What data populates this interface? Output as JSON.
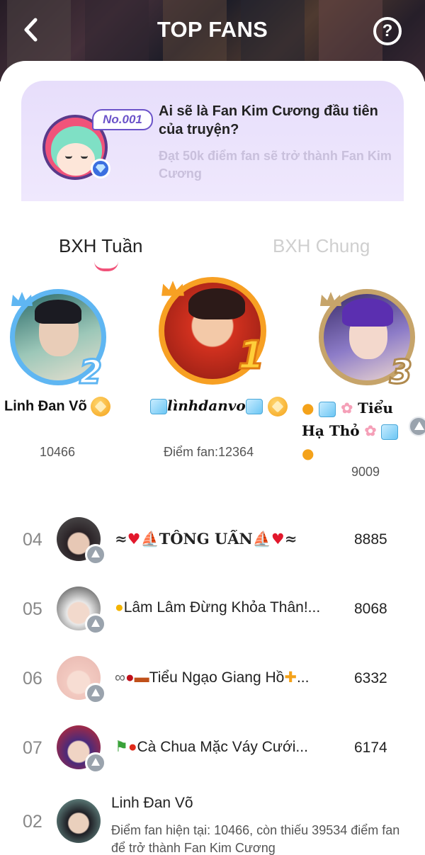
{
  "header": {
    "title": "TOP FANS"
  },
  "banner": {
    "badge": "No.001",
    "title": "Ai sẽ là Fan Kim Cương đầu tiên của truyện?",
    "subtitle": "Đạt 50k điểm fan sẽ trở thành Fan Kim Cương"
  },
  "tabs": [
    {
      "label": "BXH Tuần",
      "active": true
    },
    {
      "label": "BXH Chung",
      "active": false
    }
  ],
  "podium": [
    {
      "rank": "2",
      "name": "Linh Đan Võ",
      "score": "10466"
    },
    {
      "rank": "1",
      "name": "lìnhdanvo",
      "score": "Điểm fan:12364"
    },
    {
      "rank": "3",
      "name": "Tiểu",
      "name_line2": "Hạ Thỏ",
      "score": "9009"
    }
  ],
  "list": [
    {
      "rank": "04",
      "name": "TỐNG UẨN",
      "score": "8885"
    },
    {
      "rank": "05",
      "name": "Lâm Lâm Đừng Khỏa Thân!...",
      "score": "8068"
    },
    {
      "rank": "06",
      "name": "Tiểu Ngạo Giang Hồ",
      "score": "6332"
    },
    {
      "rank": "07",
      "name": "Cà Chua Mặc Váy Cưới...",
      "score": "6174"
    }
  ],
  "me": {
    "rank": "02",
    "name": "Linh Đan Võ",
    "detail": "Điểm fan hiện tại: 10466, còn thiếu 39534 điểm fan để trở thành Fan Kim Cương"
  },
  "colors": {
    "accent": "#f1537a",
    "banner_bg": "#ebe3fc",
    "badge": "#6b53c9"
  }
}
